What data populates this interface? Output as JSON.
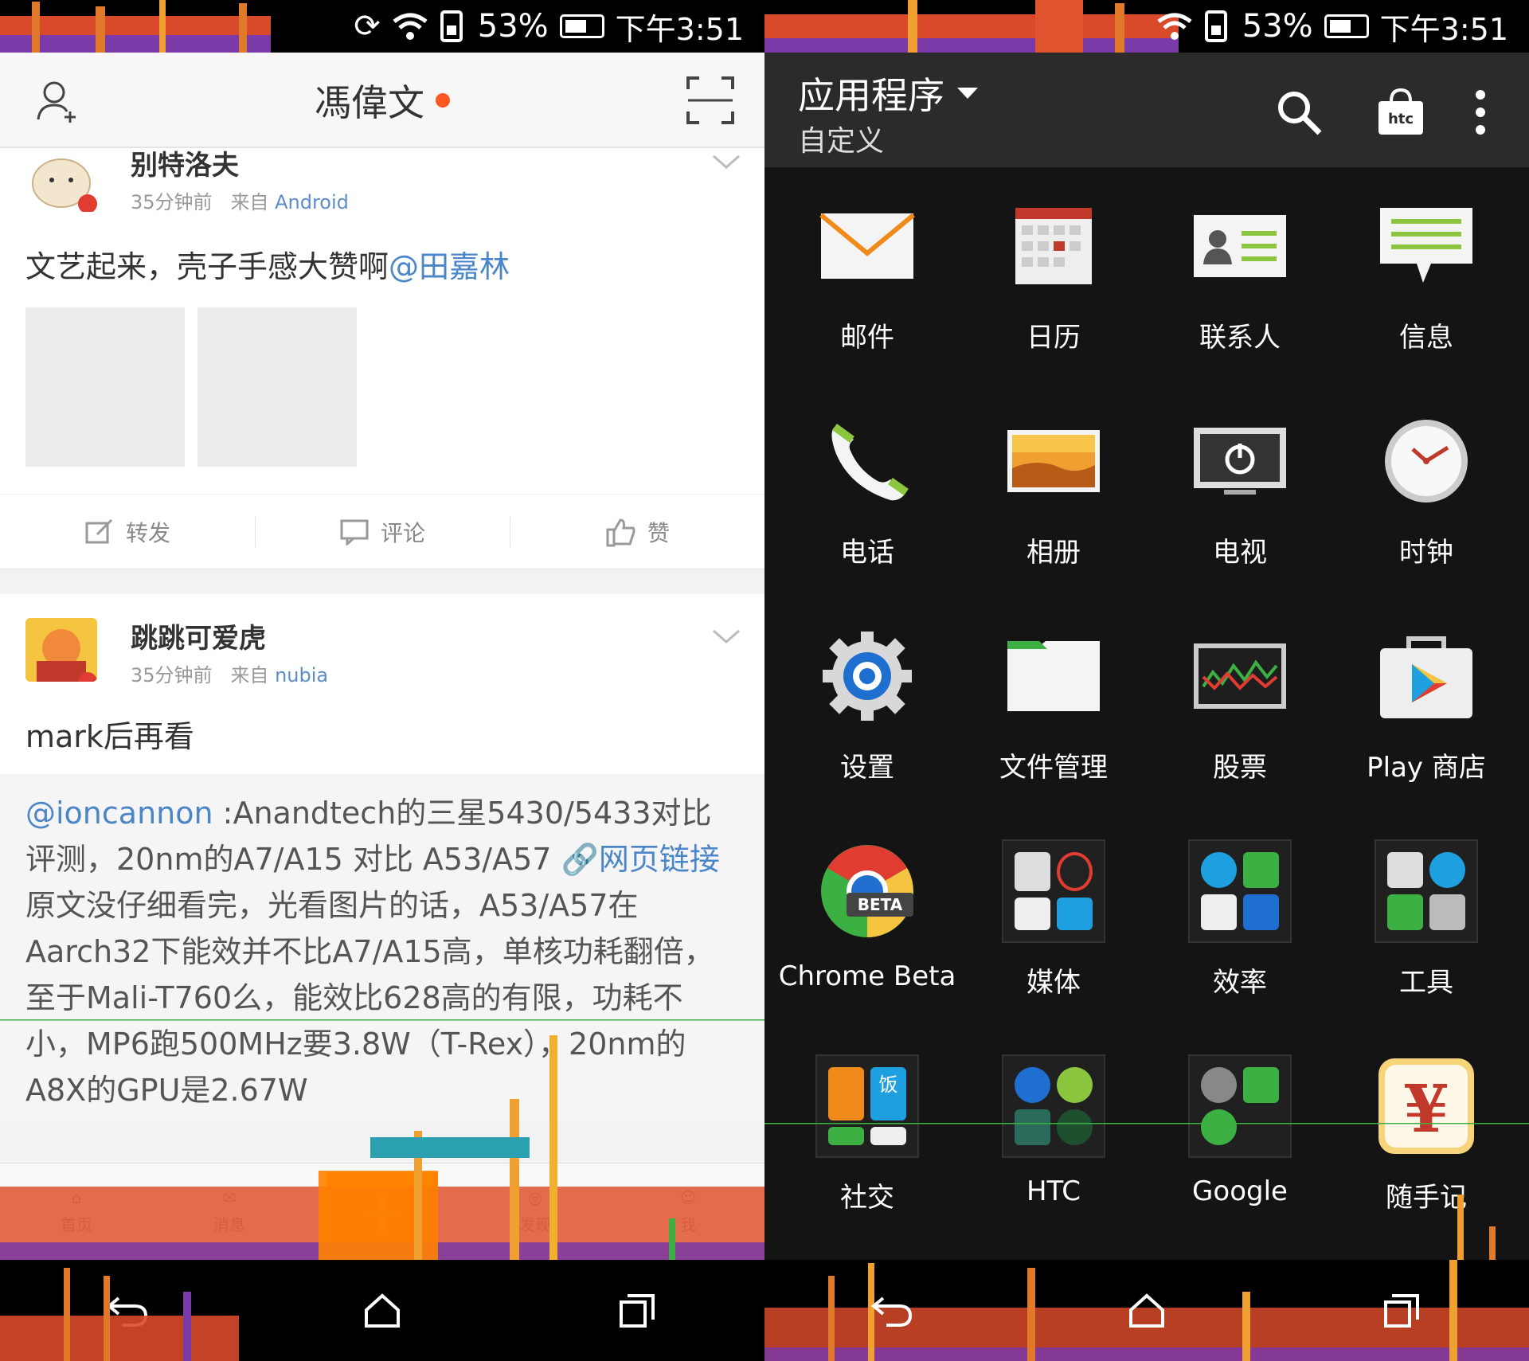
{
  "status": {
    "battery": "53%",
    "time": "下午3:51"
  },
  "weibo": {
    "header_title": "馮偉文",
    "posts": [
      {
        "name": "别特洛夫",
        "time": "35分钟前",
        "via": "来自",
        "source": "Android",
        "text": "文艺起来，壳子手感大赞啊",
        "mention": "@田嘉林"
      },
      {
        "name": "跳跳可爱虎",
        "time": "35分钟前",
        "via": "来自",
        "source": "nubia",
        "text": "mark后再看",
        "repost_mention": "@ioncannon",
        "repost_text_1": " :Anandtech的三星5430/5433对比评测，20nm的A7/A15 对比 A53/A57 ",
        "repost_link": "网页链接",
        "repost_text_2": " 原文没仔细看完，光看图片的话，A53/A57在Aarch32下能效并不比A7/A15高，单核功耗翻倍，至于Mali-T760么，能效比628高的有限，功耗不小，MP6跑500MHz要3.8W（T-Rex），20nm的A8X的GPU是2.67W"
      }
    ],
    "actions": {
      "repost": "转发",
      "comment": "评论",
      "like": "赞"
    },
    "tabs": [
      "首页",
      "消息",
      "发现",
      "我"
    ]
  },
  "launcher": {
    "title": "应用程序",
    "subtitle": "自定义",
    "apps": [
      {
        "label": "邮件",
        "icon": "mail-icon"
      },
      {
        "label": "日历",
        "icon": "calendar-icon"
      },
      {
        "label": "联系人",
        "icon": "contacts-icon"
      },
      {
        "label": "信息",
        "icon": "messages-icon"
      },
      {
        "label": "电话",
        "icon": "phone-icon"
      },
      {
        "label": "相册",
        "icon": "gallery-icon"
      },
      {
        "label": "电视",
        "icon": "tv-icon"
      },
      {
        "label": "时钟",
        "icon": "clock-icon"
      },
      {
        "label": "设置",
        "icon": "settings-icon"
      },
      {
        "label": "文件管理",
        "icon": "folder-icon"
      },
      {
        "label": "股票",
        "icon": "stocks-icon"
      },
      {
        "label": "Play 商店",
        "icon": "play-store-icon"
      },
      {
        "label": "Chrome Beta",
        "icon": "chrome-beta-icon",
        "badge": "BETA"
      },
      {
        "label": "媒体",
        "icon": "media-folder-icon"
      },
      {
        "label": "效率",
        "icon": "productivity-folder-icon"
      },
      {
        "label": "工具",
        "icon": "tools-folder-icon"
      },
      {
        "label": "社交",
        "icon": "social-folder-icon",
        "folder_items": [
          "weibo",
          "饭",
          "wechat",
          "qq"
        ]
      },
      {
        "label": "HTC",
        "icon": "htc-folder-icon"
      },
      {
        "label": "Google",
        "icon": "google-folder-icon"
      },
      {
        "label": "随手记",
        "icon": "yuan-icon",
        "glyph": "¥"
      }
    ]
  },
  "colors": {
    "weibo_accent": "#ff8200",
    "mention": "#4a86c8",
    "launcher_bg": "#141414"
  }
}
